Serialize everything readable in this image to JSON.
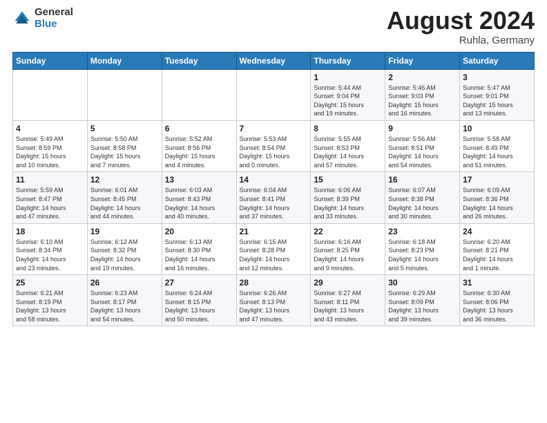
{
  "header": {
    "logo_general": "General",
    "logo_blue": "Blue",
    "title": "August 2024",
    "location": "Ruhla, Germany"
  },
  "days_of_week": [
    "Sunday",
    "Monday",
    "Tuesday",
    "Wednesday",
    "Thursday",
    "Friday",
    "Saturday"
  ],
  "weeks": [
    [
      {
        "day": "",
        "info": ""
      },
      {
        "day": "",
        "info": ""
      },
      {
        "day": "",
        "info": ""
      },
      {
        "day": "",
        "info": ""
      },
      {
        "day": "1",
        "info": "Sunrise: 5:44 AM\nSunset: 9:04 PM\nDaylight: 15 hours\nand 19 minutes."
      },
      {
        "day": "2",
        "info": "Sunrise: 5:46 AM\nSunset: 9:03 PM\nDaylight: 15 hours\nand 16 minutes."
      },
      {
        "day": "3",
        "info": "Sunrise: 5:47 AM\nSunset: 9:01 PM\nDaylight: 15 hours\nand 13 minutes."
      }
    ],
    [
      {
        "day": "4",
        "info": "Sunrise: 5:49 AM\nSunset: 8:59 PM\nDaylight: 15 hours\nand 10 minutes."
      },
      {
        "day": "5",
        "info": "Sunrise: 5:50 AM\nSunset: 8:58 PM\nDaylight: 15 hours\nand 7 minutes."
      },
      {
        "day": "6",
        "info": "Sunrise: 5:52 AM\nSunset: 8:56 PM\nDaylight: 15 hours\nand 4 minutes."
      },
      {
        "day": "7",
        "info": "Sunrise: 5:53 AM\nSunset: 8:54 PM\nDaylight: 15 hours\nand 0 minutes."
      },
      {
        "day": "8",
        "info": "Sunrise: 5:55 AM\nSunset: 8:53 PM\nDaylight: 14 hours\nand 57 minutes."
      },
      {
        "day": "9",
        "info": "Sunrise: 5:56 AM\nSunset: 8:51 PM\nDaylight: 14 hours\nand 54 minutes."
      },
      {
        "day": "10",
        "info": "Sunrise: 5:58 AM\nSunset: 8:49 PM\nDaylight: 14 hours\nand 51 minutes."
      }
    ],
    [
      {
        "day": "11",
        "info": "Sunrise: 5:59 AM\nSunset: 8:47 PM\nDaylight: 14 hours\nand 47 minutes."
      },
      {
        "day": "12",
        "info": "Sunrise: 6:01 AM\nSunset: 8:45 PM\nDaylight: 14 hours\nand 44 minutes."
      },
      {
        "day": "13",
        "info": "Sunrise: 6:03 AM\nSunset: 8:43 PM\nDaylight: 14 hours\nand 40 minutes."
      },
      {
        "day": "14",
        "info": "Sunrise: 6:04 AM\nSunset: 8:41 PM\nDaylight: 14 hours\nand 37 minutes."
      },
      {
        "day": "15",
        "info": "Sunrise: 6:06 AM\nSunset: 8:39 PM\nDaylight: 14 hours\nand 33 minutes."
      },
      {
        "day": "16",
        "info": "Sunrise: 6:07 AM\nSunset: 8:38 PM\nDaylight: 14 hours\nand 30 minutes."
      },
      {
        "day": "17",
        "info": "Sunrise: 6:09 AM\nSunset: 8:36 PM\nDaylight: 14 hours\nand 26 minutes."
      }
    ],
    [
      {
        "day": "18",
        "info": "Sunrise: 6:10 AM\nSunset: 8:34 PM\nDaylight: 14 hours\nand 23 minutes."
      },
      {
        "day": "19",
        "info": "Sunrise: 6:12 AM\nSunset: 8:32 PM\nDaylight: 14 hours\nand 19 minutes."
      },
      {
        "day": "20",
        "info": "Sunrise: 6:13 AM\nSunset: 8:30 PM\nDaylight: 14 hours\nand 16 minutes."
      },
      {
        "day": "21",
        "info": "Sunrise: 6:15 AM\nSunset: 8:28 PM\nDaylight: 14 hours\nand 12 minutes."
      },
      {
        "day": "22",
        "info": "Sunrise: 6:16 AM\nSunset: 8:25 PM\nDaylight: 14 hours\nand 9 minutes."
      },
      {
        "day": "23",
        "info": "Sunrise: 6:18 AM\nSunset: 8:23 PM\nDaylight: 14 hours\nand 5 minutes."
      },
      {
        "day": "24",
        "info": "Sunrise: 6:20 AM\nSunset: 8:21 PM\nDaylight: 14 hours\nand 1 minute."
      }
    ],
    [
      {
        "day": "25",
        "info": "Sunrise: 6:21 AM\nSunset: 8:19 PM\nDaylight: 13 hours\nand 58 minutes."
      },
      {
        "day": "26",
        "info": "Sunrise: 6:23 AM\nSunset: 8:17 PM\nDaylight: 13 hours\nand 54 minutes."
      },
      {
        "day": "27",
        "info": "Sunrise: 6:24 AM\nSunset: 8:15 PM\nDaylight: 13 hours\nand 50 minutes."
      },
      {
        "day": "28",
        "info": "Sunrise: 6:26 AM\nSunset: 8:13 PM\nDaylight: 13 hours\nand 47 minutes."
      },
      {
        "day": "29",
        "info": "Sunrise: 6:27 AM\nSunset: 8:11 PM\nDaylight: 13 hours\nand 43 minutes."
      },
      {
        "day": "30",
        "info": "Sunrise: 6:29 AM\nSunset: 8:09 PM\nDaylight: 13 hours\nand 39 minutes."
      },
      {
        "day": "31",
        "info": "Sunrise: 6:30 AM\nSunset: 8:06 PM\nDaylight: 13 hours\nand 36 minutes."
      }
    ]
  ]
}
